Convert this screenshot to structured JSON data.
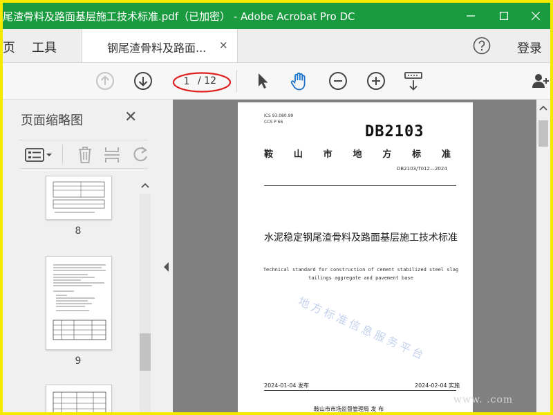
{
  "window": {
    "title": "尾渣骨料及路面基层施工技术标准.pdf（已加密） - Adobe Acrobat Pro DC",
    "title_color": "#1a9b3f",
    "border_color": "#f5e900"
  },
  "tabs": {
    "left_cut": "页",
    "tools": "工具",
    "document": "钢尾渣骨料及路面...",
    "close": "×",
    "login": "登录"
  },
  "toolbar": {
    "page_current": "1",
    "page_total": "/ 12",
    "highlight_color": "#e02020",
    "accent_color": "#1a73c8"
  },
  "thumbnail_panel": {
    "title": "页面缩略图",
    "close": "✕",
    "pages": [
      {
        "number": "8"
      },
      {
        "number": "9"
      }
    ]
  },
  "document_page": {
    "ics": "ICS 93.080.99",
    "ccs": "CCS P 66",
    "code": "DB2103",
    "city_chars": [
      "鞍",
      "山",
      "市",
      "地",
      "方",
      "标",
      "准"
    ],
    "std_number": "DB2103/T012—2024",
    "title": "水泥稳定钢尾渣骨料及路面基层施工技术标准",
    "english_title": "Technical standard for construction of cement stabilized steel slag tailings aggregate and pavement base",
    "watermark": "地方标准信息服务平台",
    "issue_date": "2024-01-04 发布",
    "impl_date": "2024-02-04 实施",
    "publisher": "鞍山市市场监督管理局    发 布"
  },
  "corner_watermark": "www.     .com"
}
